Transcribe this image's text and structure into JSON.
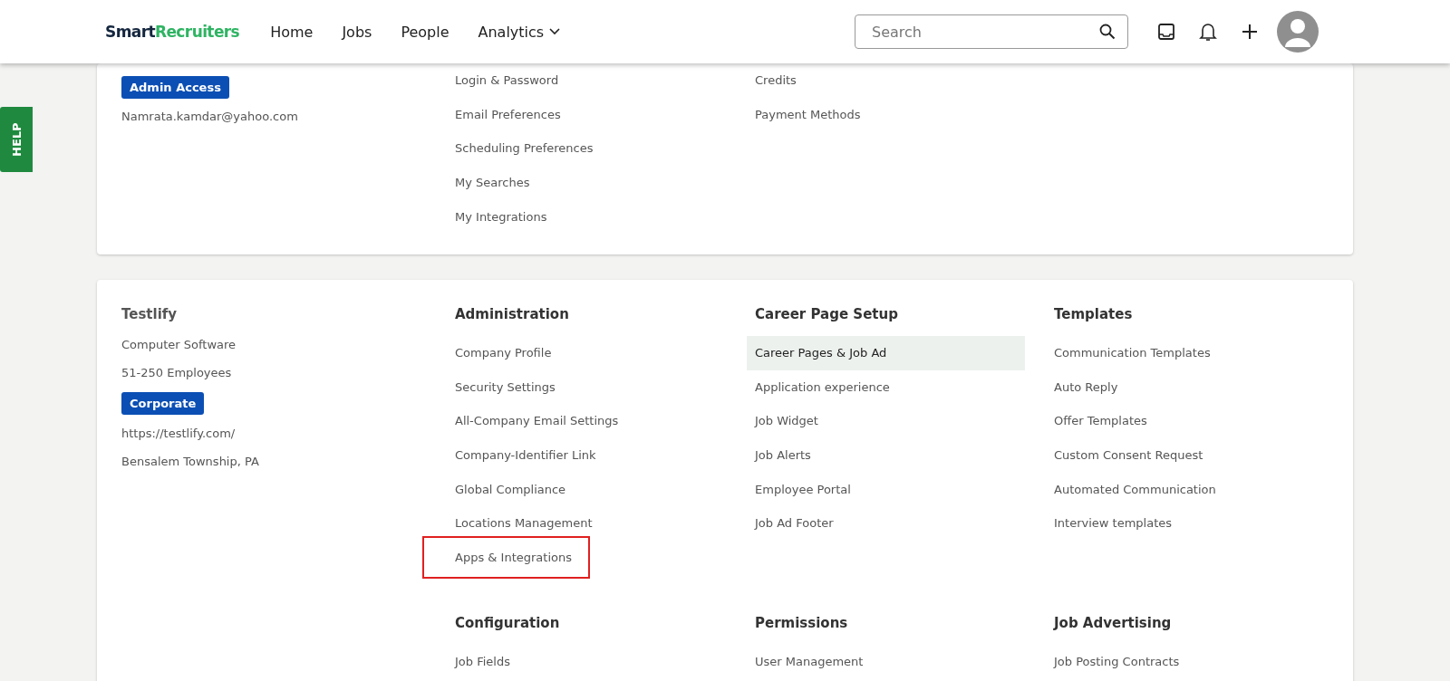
{
  "header": {
    "logo": {
      "dark": "Smart",
      "green": "Recruiters"
    },
    "nav": [
      {
        "label": "Home",
        "has_menu": false
      },
      {
        "label": "Jobs",
        "has_menu": false
      },
      {
        "label": "People",
        "has_menu": false
      },
      {
        "label": "Analytics",
        "has_menu": true
      }
    ],
    "search": {
      "placeholder": "Search"
    }
  },
  "help_tab": {
    "label": "HELP"
  },
  "account_card": {
    "badge": "Admin Access",
    "email": "Namrata.kamdar@yahoo.com",
    "columns": [
      [
        "Login & Password",
        "Email Preferences",
        "Scheduling Preferences",
        "My Searches",
        "My Integrations"
      ],
      [
        "Credits",
        "Payment Methods"
      ]
    ]
  },
  "company_card": {
    "name": "Testlify",
    "info": [
      {
        "kind": "text",
        "text": "Computer Software"
      },
      {
        "kind": "text",
        "text": "51-250 Employees"
      },
      {
        "kind": "badge",
        "text": "Corporate"
      },
      {
        "kind": "text",
        "text": "https://testlify.com/"
      },
      {
        "kind": "text",
        "text": "Bensalem Township, PA"
      }
    ],
    "sections": [
      {
        "title": "Administration",
        "items": [
          {
            "label": "Company Profile",
            "selected": false,
            "highlighted": false
          },
          {
            "label": "Security Settings",
            "selected": false,
            "highlighted": false
          },
          {
            "label": "All-Company Email Settings",
            "selected": false,
            "highlighted": false
          },
          {
            "label": "Company-Identifier Link",
            "selected": false,
            "highlighted": false
          },
          {
            "label": "Global Compliance",
            "selected": false,
            "highlighted": false
          },
          {
            "label": "Locations Management",
            "selected": false,
            "highlighted": false
          },
          {
            "label": "Apps & Integrations",
            "selected": false,
            "highlighted": true
          }
        ]
      },
      {
        "title": "Career Page Setup",
        "items": [
          {
            "label": "Career Pages & Job Ad",
            "selected": true,
            "highlighted": false
          },
          {
            "label": "Application experience",
            "selected": false,
            "highlighted": false
          },
          {
            "label": "Job Widget",
            "selected": false,
            "highlighted": false
          },
          {
            "label": "Job Alerts",
            "selected": false,
            "highlighted": false
          },
          {
            "label": "Employee Portal",
            "selected": false,
            "highlighted": false
          },
          {
            "label": "Job Ad Footer",
            "selected": false,
            "highlighted": false
          }
        ]
      },
      {
        "title": "Templates",
        "items": [
          {
            "label": "Communication Templates",
            "selected": false,
            "highlighted": false
          },
          {
            "label": "Auto Reply",
            "selected": false,
            "highlighted": false
          },
          {
            "label": "Offer Templates",
            "selected": false,
            "highlighted": false
          },
          {
            "label": "Custom Consent Request",
            "selected": false,
            "highlighted": false
          },
          {
            "label": "Automated Communication",
            "selected": false,
            "highlighted": false
          },
          {
            "label": "Interview templates",
            "selected": false,
            "highlighted": false
          }
        ]
      },
      {
        "title": "Configuration",
        "items": [
          {
            "label": "Job Fields",
            "selected": false,
            "highlighted": false
          }
        ]
      },
      {
        "title": "Permissions",
        "items": [
          {
            "label": "User Management",
            "selected": false,
            "highlighted": false
          }
        ]
      },
      {
        "title": "Job Advertising",
        "items": [
          {
            "label": "Job Posting Contracts",
            "selected": false,
            "highlighted": false
          }
        ]
      }
    ]
  }
}
